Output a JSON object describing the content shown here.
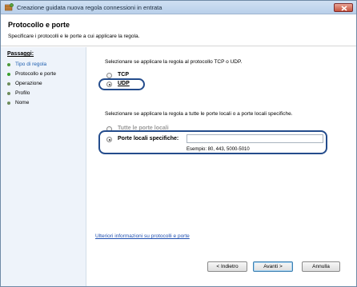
{
  "window": {
    "title": "Creazione guidata nuova regola connessioni in entrata",
    "close_icon": "close-icon"
  },
  "header": {
    "title": "Protocollo e porte",
    "description": "Specificare i protocolli e le porte a cui applicare la regola."
  },
  "sidebar": {
    "heading": "Passaggi:",
    "steps": [
      {
        "label": "Tipo di regola",
        "state": "done"
      },
      {
        "label": "Protocollo e porte",
        "state": "active"
      },
      {
        "label": "Operazione",
        "state": "pending"
      },
      {
        "label": "Profilo",
        "state": "pending"
      },
      {
        "label": "Nome",
        "state": "pending"
      }
    ]
  },
  "protocol": {
    "question": "Selezionare se applicare la regola al protocollo TCP o UDP.",
    "options": [
      {
        "label": "TCP",
        "checked": false
      },
      {
        "label": "UDP",
        "checked": true
      }
    ]
  },
  "ports": {
    "question": "Selezionare se applicare la regola a tutte le porte locali o a porte locali specifiche.",
    "all_ports_label": "Tutte le porte locali",
    "specific_label": "Porte locali specifiche:",
    "specific_checked": true,
    "input_value": "",
    "example": "Esempio: 80, 443, 5000-5010"
  },
  "link": "Ulteriori informazioni su protocolli e porte",
  "buttons": {
    "back": "< Indietro",
    "next": "Avanti >",
    "cancel": "Annulla"
  },
  "colors": {
    "accent": "#244c8c",
    "link": "#1f4fb0",
    "sidebar_bg": "#eef3fa"
  }
}
